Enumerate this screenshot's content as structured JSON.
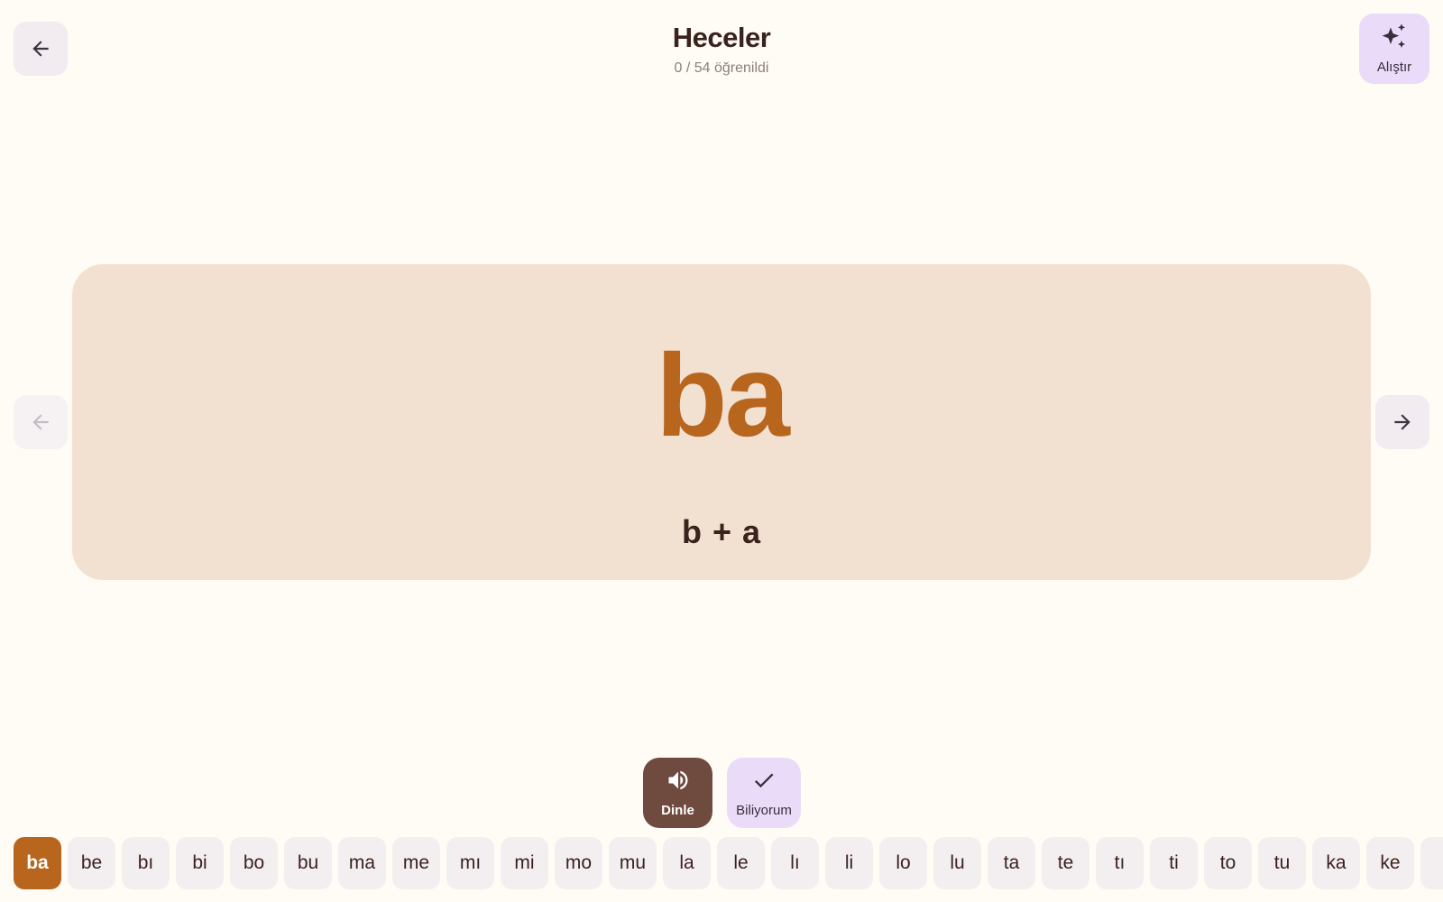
{
  "header": {
    "title": "Heceler",
    "subtitle": "0 / 54 öğrenildi",
    "back_icon": "arrow-left-icon",
    "practice": {
      "label": "Alıştır",
      "icon": "sparkles-icon"
    }
  },
  "card": {
    "syllable": "ba",
    "breakdown": "b + a"
  },
  "navigation": {
    "prev_icon": "arrow-left-icon",
    "prev_enabled": false,
    "next_icon": "arrow-right-icon"
  },
  "actions": {
    "listen": {
      "label": "Dinle",
      "icon": "volume-icon"
    },
    "know": {
      "label": "Biliyorum",
      "icon": "check-icon"
    }
  },
  "syllables": [
    "ba",
    "be",
    "bı",
    "bi",
    "bo",
    "bu",
    "ma",
    "me",
    "mı",
    "mi",
    "mo",
    "mu",
    "la",
    "le",
    "lı",
    "li",
    "lo",
    "lu",
    "ta",
    "te",
    "tı",
    "ti",
    "to",
    "tu",
    "ka",
    "ke"
  ],
  "selected_index": 0,
  "colors": {
    "accent": "#b8651e",
    "card_bg": "#f2e1d1",
    "listen_bg": "#6f4a3e",
    "lavender": "#eadcf9",
    "page_bg": "#fffcf6"
  }
}
